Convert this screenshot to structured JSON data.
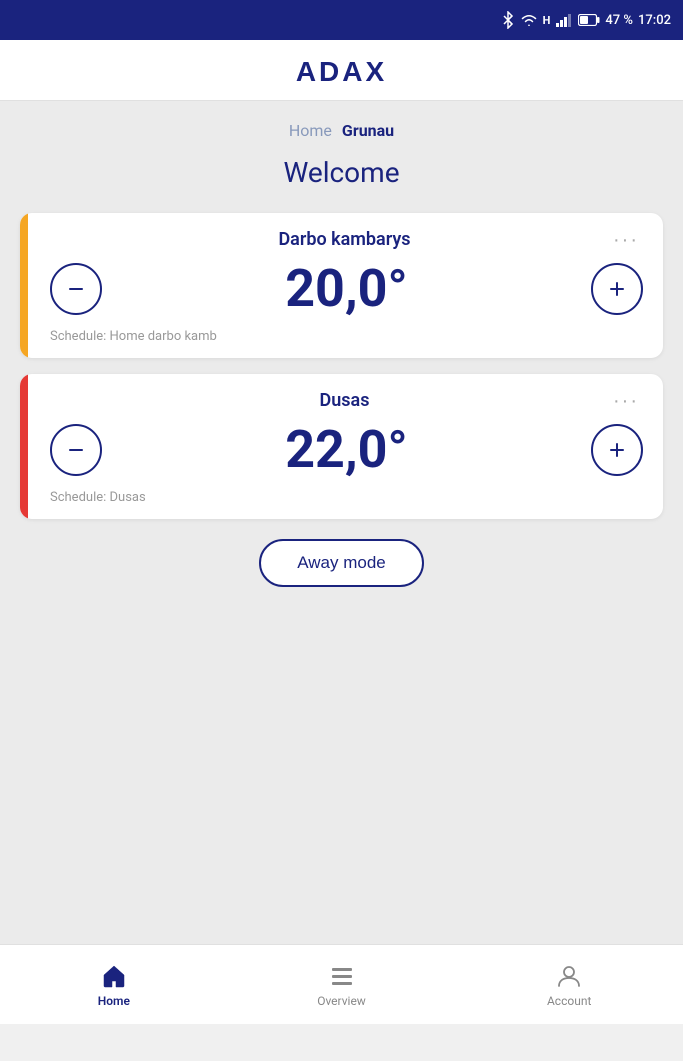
{
  "statusBar": {
    "battery": "47 %",
    "time": "17:02"
  },
  "header": {
    "logo": "ADAX"
  },
  "breadcrumb": {
    "home": "Home",
    "active": "Grunau"
  },
  "welcomeTitle": "Welcome",
  "devices": [
    {
      "id": "darbo-kambarys",
      "name": "Darbo kambarys",
      "temperature": "20,0°",
      "schedule": "Schedule: Home darbo kamb",
      "barColor": "#f5a623"
    },
    {
      "id": "dusas",
      "name": "Dusas",
      "temperature": "22,0°",
      "schedule": "Schedule: Dusas",
      "barColor": "#e53935"
    }
  ],
  "awayModeButton": "Away mode",
  "bottomNav": {
    "items": [
      {
        "id": "home",
        "label": "Home",
        "active": true
      },
      {
        "id": "overview",
        "label": "Overview",
        "active": false
      },
      {
        "id": "account",
        "label": "Account",
        "active": false
      }
    ]
  },
  "icons": {
    "bluetooth": "⚡",
    "wifi": "▲",
    "signal": "▄",
    "battery": "▪"
  }
}
